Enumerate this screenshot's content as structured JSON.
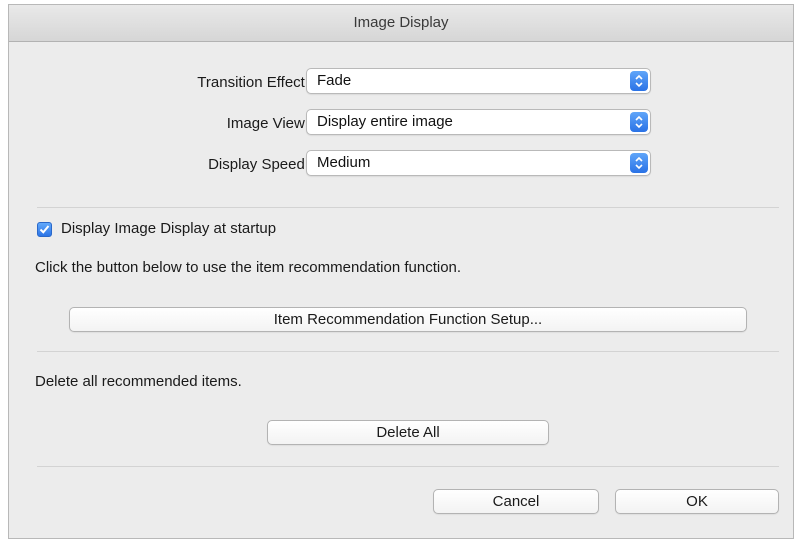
{
  "window": {
    "title": "Image Display"
  },
  "settings": {
    "transition_effect": {
      "label": "Transition Effect:",
      "value": "Fade"
    },
    "image_view": {
      "label": "Image View:",
      "value": "Display entire image"
    },
    "display_speed": {
      "label": "Display Speed:",
      "value": "Medium"
    }
  },
  "startup": {
    "checkbox_label": "Display Image Display at startup",
    "checked": true
  },
  "recommendation": {
    "instruction": "Click the button below to use the item recommendation function.",
    "setup_button": "Item Recommendation Function Setup..."
  },
  "delete": {
    "instruction": "Delete all recommended items.",
    "button": "Delete All"
  },
  "footer": {
    "cancel": "Cancel",
    "ok": "OK"
  },
  "colors": {
    "accent": "#2b74e6",
    "window_bg": "#ececec"
  },
  "icons": {
    "popup_stepper": "up-down-chevron-icon",
    "checkbox": "checkmark-icon"
  }
}
